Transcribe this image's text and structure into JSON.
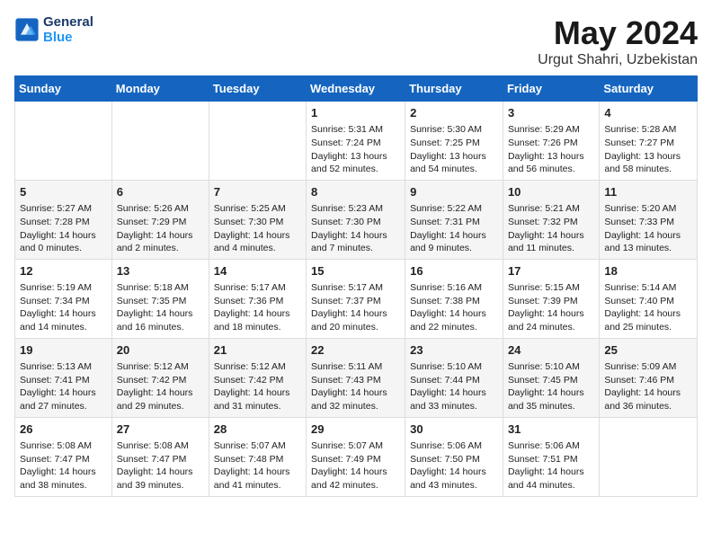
{
  "header": {
    "logo_line1": "General",
    "logo_line2": "Blue",
    "month_title": "May 2024",
    "location": "Urgut Shahri, Uzbekistan"
  },
  "weekdays": [
    "Sunday",
    "Monday",
    "Tuesday",
    "Wednesday",
    "Thursday",
    "Friday",
    "Saturday"
  ],
  "weeks": [
    [
      {
        "day": "",
        "info": ""
      },
      {
        "day": "",
        "info": ""
      },
      {
        "day": "",
        "info": ""
      },
      {
        "day": "1",
        "info": "Sunrise: 5:31 AM\nSunset: 7:24 PM\nDaylight: 13 hours and 52 minutes."
      },
      {
        "day": "2",
        "info": "Sunrise: 5:30 AM\nSunset: 7:25 PM\nDaylight: 13 hours and 54 minutes."
      },
      {
        "day": "3",
        "info": "Sunrise: 5:29 AM\nSunset: 7:26 PM\nDaylight: 13 hours and 56 minutes."
      },
      {
        "day": "4",
        "info": "Sunrise: 5:28 AM\nSunset: 7:27 PM\nDaylight: 13 hours and 58 minutes."
      }
    ],
    [
      {
        "day": "5",
        "info": "Sunrise: 5:27 AM\nSunset: 7:28 PM\nDaylight: 14 hours and 0 minutes."
      },
      {
        "day": "6",
        "info": "Sunrise: 5:26 AM\nSunset: 7:29 PM\nDaylight: 14 hours and 2 minutes."
      },
      {
        "day": "7",
        "info": "Sunrise: 5:25 AM\nSunset: 7:30 PM\nDaylight: 14 hours and 4 minutes."
      },
      {
        "day": "8",
        "info": "Sunrise: 5:23 AM\nSunset: 7:30 PM\nDaylight: 14 hours and 7 minutes."
      },
      {
        "day": "9",
        "info": "Sunrise: 5:22 AM\nSunset: 7:31 PM\nDaylight: 14 hours and 9 minutes."
      },
      {
        "day": "10",
        "info": "Sunrise: 5:21 AM\nSunset: 7:32 PM\nDaylight: 14 hours and 11 minutes."
      },
      {
        "day": "11",
        "info": "Sunrise: 5:20 AM\nSunset: 7:33 PM\nDaylight: 14 hours and 13 minutes."
      }
    ],
    [
      {
        "day": "12",
        "info": "Sunrise: 5:19 AM\nSunset: 7:34 PM\nDaylight: 14 hours and 14 minutes."
      },
      {
        "day": "13",
        "info": "Sunrise: 5:18 AM\nSunset: 7:35 PM\nDaylight: 14 hours and 16 minutes."
      },
      {
        "day": "14",
        "info": "Sunrise: 5:17 AM\nSunset: 7:36 PM\nDaylight: 14 hours and 18 minutes."
      },
      {
        "day": "15",
        "info": "Sunrise: 5:17 AM\nSunset: 7:37 PM\nDaylight: 14 hours and 20 minutes."
      },
      {
        "day": "16",
        "info": "Sunrise: 5:16 AM\nSunset: 7:38 PM\nDaylight: 14 hours and 22 minutes."
      },
      {
        "day": "17",
        "info": "Sunrise: 5:15 AM\nSunset: 7:39 PM\nDaylight: 14 hours and 24 minutes."
      },
      {
        "day": "18",
        "info": "Sunrise: 5:14 AM\nSunset: 7:40 PM\nDaylight: 14 hours and 25 minutes."
      }
    ],
    [
      {
        "day": "19",
        "info": "Sunrise: 5:13 AM\nSunset: 7:41 PM\nDaylight: 14 hours and 27 minutes."
      },
      {
        "day": "20",
        "info": "Sunrise: 5:12 AM\nSunset: 7:42 PM\nDaylight: 14 hours and 29 minutes."
      },
      {
        "day": "21",
        "info": "Sunrise: 5:12 AM\nSunset: 7:42 PM\nDaylight: 14 hours and 31 minutes."
      },
      {
        "day": "22",
        "info": "Sunrise: 5:11 AM\nSunset: 7:43 PM\nDaylight: 14 hours and 32 minutes."
      },
      {
        "day": "23",
        "info": "Sunrise: 5:10 AM\nSunset: 7:44 PM\nDaylight: 14 hours and 33 minutes."
      },
      {
        "day": "24",
        "info": "Sunrise: 5:10 AM\nSunset: 7:45 PM\nDaylight: 14 hours and 35 minutes."
      },
      {
        "day": "25",
        "info": "Sunrise: 5:09 AM\nSunset: 7:46 PM\nDaylight: 14 hours and 36 minutes."
      }
    ],
    [
      {
        "day": "26",
        "info": "Sunrise: 5:08 AM\nSunset: 7:47 PM\nDaylight: 14 hours and 38 minutes."
      },
      {
        "day": "27",
        "info": "Sunrise: 5:08 AM\nSunset: 7:47 PM\nDaylight: 14 hours and 39 minutes."
      },
      {
        "day": "28",
        "info": "Sunrise: 5:07 AM\nSunset: 7:48 PM\nDaylight: 14 hours and 41 minutes."
      },
      {
        "day": "29",
        "info": "Sunrise: 5:07 AM\nSunset: 7:49 PM\nDaylight: 14 hours and 42 minutes."
      },
      {
        "day": "30",
        "info": "Sunrise: 5:06 AM\nSunset: 7:50 PM\nDaylight: 14 hours and 43 minutes."
      },
      {
        "day": "31",
        "info": "Sunrise: 5:06 AM\nSunset: 7:51 PM\nDaylight: 14 hours and 44 minutes."
      },
      {
        "day": "",
        "info": ""
      }
    ]
  ]
}
